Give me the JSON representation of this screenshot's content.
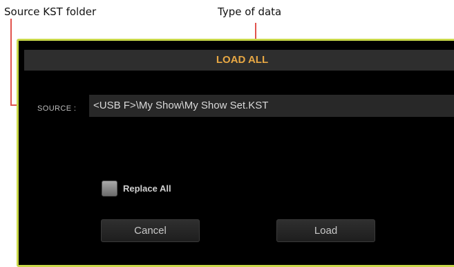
{
  "annotations": {
    "source_folder": "Source KST folder",
    "type_of_data": "Type of data"
  },
  "dialog": {
    "title": "LOAD ALL",
    "source_label": "SOURCE :",
    "source_value": "<USB F>\\My Show\\My Show Set.KST",
    "replace_all_label": "Replace All",
    "replace_all_checked": false,
    "cancel_label": "Cancel",
    "load_label": "Load"
  },
  "colors": {
    "dialog_outline": "#c9d84a",
    "title_text": "#e8a844",
    "callout_line": "#e1524c"
  }
}
